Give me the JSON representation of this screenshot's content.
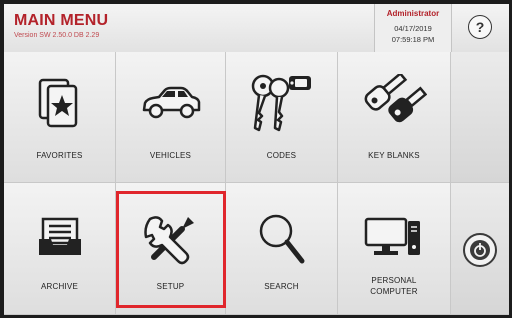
{
  "header": {
    "title": "MAIN MENU",
    "version": "Version SW 2.50.0 DB 2.29",
    "user": "Administrator",
    "date": "04/17/2019",
    "time": "07:59:18 PM",
    "help_label": "?"
  },
  "tiles": [
    {
      "label": "FAVORITES",
      "icon": "favorites-card-star-icon"
    },
    {
      "label": "VEHICLES",
      "icon": "car-icon"
    },
    {
      "label": "CODES",
      "icon": "keys-with-tag-icon"
    },
    {
      "label": "KEY BLANKS",
      "icon": "key-blanks-icon"
    },
    {
      "label": "ARCHIVE",
      "icon": "archive-tray-icon"
    },
    {
      "label": "SETUP",
      "icon": "wrench-screwdriver-icon"
    },
    {
      "label": "SEARCH",
      "icon": "magnifier-icon"
    },
    {
      "label": "PERSONAL\nCOMPUTER",
      "icon": "desktop-computer-icon"
    }
  ],
  "side": {
    "power_icon": "power-icon"
  },
  "colors": {
    "brand_red": "#b3222a",
    "highlight_red": "#e0262c"
  }
}
